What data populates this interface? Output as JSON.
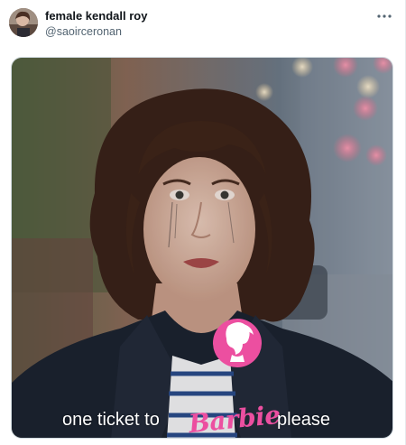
{
  "tweet": {
    "display_name": "female kendall roy",
    "handle": "@saoirceronan",
    "more_icon": "more-horizontal-icon"
  },
  "media": {
    "caption_before": "one ticket to",
    "caption_brand": "Barbie",
    "caption_after": "please",
    "brand_color": "#ec4fa0"
  }
}
